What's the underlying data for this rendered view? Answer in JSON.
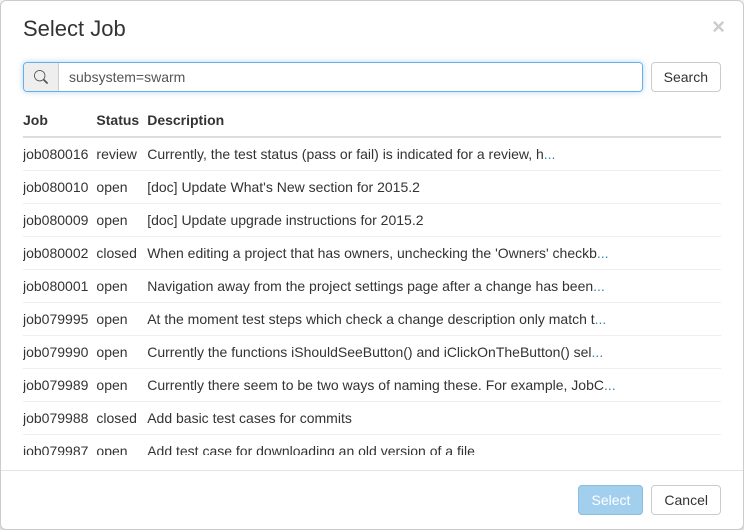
{
  "header": {
    "title": "Select Job",
    "close_label": "×"
  },
  "search": {
    "icon": "search-icon",
    "value": "subsystem=swarm",
    "button_label": "Search"
  },
  "table": {
    "headers": {
      "job": "Job",
      "status": "Status",
      "description": "Description"
    },
    "rows": [
      {
        "job": "job080016",
        "status": "review",
        "desc": "Currently, the test status (pass or fail) is indicated for a review, h",
        "truncated": true
      },
      {
        "job": "job080010",
        "status": "open",
        "desc": "[doc] Update What's New section for 2015.2",
        "truncated": false
      },
      {
        "job": "job080009",
        "status": "open",
        "desc": "[doc] Update upgrade instructions for 2015.2",
        "truncated": false
      },
      {
        "job": "job080002",
        "status": "closed",
        "desc": "When editing a project that has owners, unchecking the 'Owners' checkb",
        "truncated": true
      },
      {
        "job": "job080001",
        "status": "open",
        "desc": "Navigation away from the project settings page after a change has been",
        "truncated": true
      },
      {
        "job": "job079995",
        "status": "open",
        "desc": "At the moment test steps which check a change description only match t",
        "truncated": true
      },
      {
        "job": "job079990",
        "status": "open",
        "desc": "Currently the functions iShouldSeeButton() and iClickOnTheButton() sel",
        "truncated": true
      },
      {
        "job": "job079989",
        "status": "open",
        "desc": "Currently there seem to be two ways of naming these. For example, JobC",
        "truncated": true
      },
      {
        "job": "job079988",
        "status": "closed",
        "desc": "Add basic test cases for commits",
        "truncated": false
      },
      {
        "job": "job079987",
        "status": "open",
        "desc": "Add test case for downloading an old version of a file",
        "truncated": false
      }
    ]
  },
  "footer": {
    "select_label": "Select",
    "cancel_label": "Cancel"
  },
  "ellipsis": "..."
}
